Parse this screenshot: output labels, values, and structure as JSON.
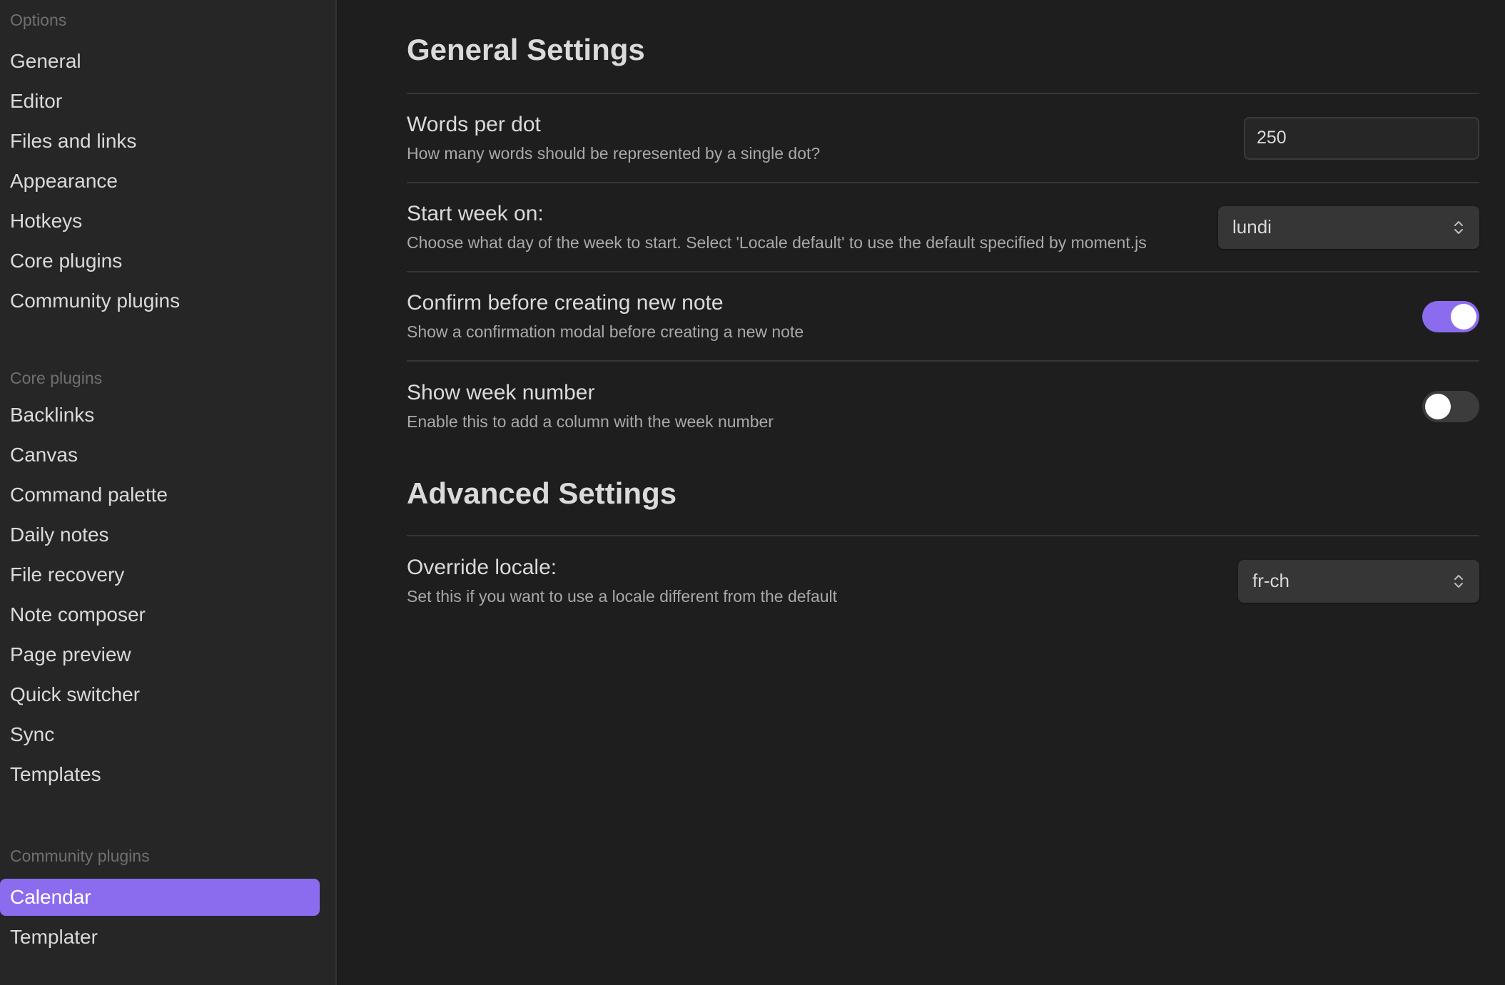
{
  "sidebar": {
    "options_title": "Options",
    "options_items": [
      "General",
      "Editor",
      "Files and links",
      "Appearance",
      "Hotkeys",
      "Core plugins",
      "Community plugins"
    ],
    "core_title": "Core plugins",
    "core_items": [
      "Backlinks",
      "Canvas",
      "Command palette",
      "Daily notes",
      "File recovery",
      "Note composer",
      "Page preview",
      "Quick switcher",
      "Sync",
      "Templates"
    ],
    "community_title": "Community plugins",
    "community_items": [
      "Calendar",
      "Templater"
    ],
    "active_item": "Calendar"
  },
  "main": {
    "general_title": "General Settings",
    "words_per_dot": {
      "name": "Words per dot",
      "desc": "How many words should be represented by a single dot?",
      "value": "250"
    },
    "start_week": {
      "name": "Start week on:",
      "desc": "Choose what day of the week to start. Select 'Locale default' to use the default specified by moment.js",
      "value": "lundi"
    },
    "confirm_new_note": {
      "name": "Confirm before creating new note",
      "desc": "Show a confirmation modal before creating a new note",
      "enabled": true
    },
    "show_week_number": {
      "name": "Show week number",
      "desc": "Enable this to add a column with the week number",
      "enabled": false
    },
    "advanced_title": "Advanced Settings",
    "override_locale": {
      "name": "Override locale:",
      "desc": "Set this if you want to use a locale different from the default",
      "value": "fr-ch"
    }
  },
  "colors": {
    "accent": "#8b6cef",
    "background": "#1e1e1e",
    "sidebar": "#262626"
  }
}
